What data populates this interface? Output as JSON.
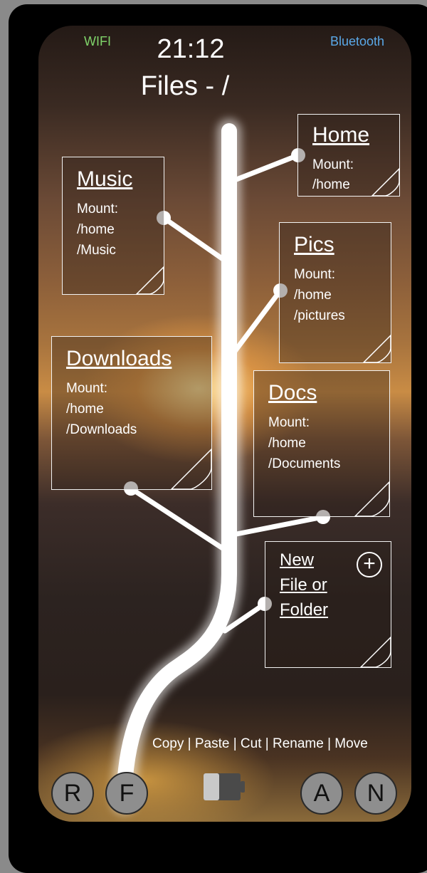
{
  "status_bar": {
    "wifi_label": "WIFI",
    "bluetooth_label": "Bluetooth",
    "time": "21:12",
    "wifi_color": "#7fd36a",
    "bluetooth_color": "#5aa8e8"
  },
  "header": {
    "title": "Files - /"
  },
  "folders": [
    {
      "name": "Home",
      "mount_label": "Mount:",
      "path": [
        "/home"
      ]
    },
    {
      "name": "Music",
      "mount_label": "Mount:",
      "path": [
        "/home",
        "/Music"
      ]
    },
    {
      "name": "Pics",
      "mount_label": "Mount:",
      "path": [
        "/home",
        "/pictures"
      ]
    },
    {
      "name": "Downloads",
      "mount_label": "Mount:",
      "path": [
        "/home",
        "/Downloads"
      ]
    },
    {
      "name": "Docs",
      "mount_label": "Mount:",
      "path": [
        "/home",
        "/Documents"
      ]
    }
  ],
  "new_item": {
    "lines": [
      "New",
      "File or",
      "Folder"
    ],
    "icon": "plus-circle-icon"
  },
  "actions": {
    "text": "Copy | Paste | Cut | Rename | Move"
  },
  "bottom_bar": {
    "left_buttons": [
      "R",
      "F"
    ],
    "right_buttons": [
      "A",
      "N"
    ],
    "battery_icon": "battery-icon"
  }
}
